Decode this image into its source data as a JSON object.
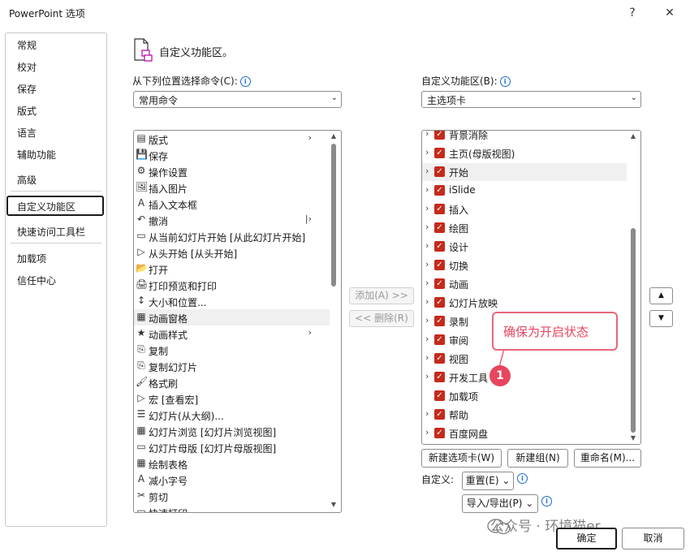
{
  "window": {
    "title": "PowerPoint 选项",
    "help": "?",
    "close": "✕"
  },
  "sidebar": {
    "items": [
      {
        "label": "常规"
      },
      {
        "label": "校对"
      },
      {
        "label": "保存"
      },
      {
        "label": "版式"
      },
      {
        "label": "语言"
      },
      {
        "label": "辅助功能"
      },
      {
        "label": "高级"
      },
      {
        "label": "自定义功能区",
        "selected": true
      },
      {
        "label": "快速访问工具栏"
      },
      {
        "label": "加载项"
      },
      {
        "label": "信任中心"
      }
    ]
  },
  "header": {
    "title": "自定义功能区。"
  },
  "left": {
    "label": "从下列位置选择命令(C):",
    "dropdown_value": "常用命令",
    "commands": [
      {
        "icon": "▤",
        "label": "版式",
        "sub": "›"
      },
      {
        "icon": "💾",
        "label": "保存"
      },
      {
        "icon": "⚙",
        "label": "操作设置"
      },
      {
        "icon": "🖼",
        "label": "插入图片"
      },
      {
        "icon": "A",
        "label": "插入文本框"
      },
      {
        "icon": "↶",
        "label": "撤消",
        "sub": "|›"
      },
      {
        "icon": "▭",
        "label": "从当前幻灯片开始 [从此幻灯片开始]"
      },
      {
        "icon": "▷",
        "label": "从头开始 [从头开始]"
      },
      {
        "icon": "📂",
        "label": "打开"
      },
      {
        "icon": "🖨",
        "label": "打印预览和打印"
      },
      {
        "icon": "↕",
        "label": "大小和位置..."
      },
      {
        "icon": "▦",
        "label": "动画窗格"
      },
      {
        "icon": "★",
        "label": "动画样式",
        "sub": "›"
      },
      {
        "icon": "⎘",
        "label": "复制"
      },
      {
        "icon": "⎘",
        "label": "复制幻灯片"
      },
      {
        "icon": "🖌",
        "label": "格式刷"
      },
      {
        "icon": "▷",
        "label": "宏 [查看宏]"
      },
      {
        "icon": "☰",
        "label": "幻灯片(从大纲)..."
      },
      {
        "icon": "▦",
        "label": "幻灯片浏览 [幻灯片浏览视图]"
      },
      {
        "icon": "▭",
        "label": "幻灯片母版 [幻灯片母版视图]"
      },
      {
        "icon": "▦",
        "label": "绘制表格"
      },
      {
        "icon": "A",
        "label": "减小字号"
      },
      {
        "icon": "✂",
        "label": "剪切"
      },
      {
        "icon": "▭",
        "label": "快速打印"
      }
    ],
    "scroll_position": 0.0
  },
  "middle": {
    "add": "添加(A) >>",
    "remove": "<< 删除(R)"
  },
  "right": {
    "label": "自定义功能区(B):",
    "dropdown_value": "主选项卡",
    "tabs": [
      {
        "label": "背景消除",
        "expandable": true,
        "checked": true
      },
      {
        "label": "主页(母版视图)",
        "expandable": true,
        "checked": true
      },
      {
        "label": "开始",
        "expandable": true,
        "checked": true,
        "highlighted": true
      },
      {
        "label": "iSlide",
        "expandable": true,
        "checked": true
      },
      {
        "label": "插入",
        "expandable": true,
        "checked": true
      },
      {
        "label": "绘图",
        "expandable": true,
        "checked": true
      },
      {
        "label": "设计",
        "expandable": true,
        "checked": true
      },
      {
        "label": "切换",
        "expandable": true,
        "checked": true
      },
      {
        "label": "动画",
        "expandable": true,
        "checked": true
      },
      {
        "label": "幻灯片放映",
        "expandable": true,
        "checked": true
      },
      {
        "label": "录制",
        "expandable": true,
        "checked": true
      },
      {
        "label": "审阅",
        "expandable": true,
        "checked": true
      },
      {
        "label": "视图",
        "expandable": true,
        "checked": true
      },
      {
        "label": "开发工具",
        "expandable": true,
        "checked": true
      },
      {
        "label": "加载项",
        "expandable": false,
        "checked": true
      },
      {
        "label": "帮助",
        "expandable": true,
        "checked": true
      },
      {
        "label": "百度网盘",
        "expandable": true,
        "checked": true
      }
    ],
    "move_up": "▲",
    "move_down": "▼",
    "new_tab": "新建选项卡(W)",
    "new_group": "新建组(N)",
    "rename": "重命名(M)...",
    "customize_label": "自定义:",
    "reset": "重置(E) ⌄",
    "import_export": "导入/导出(P) ⌄"
  },
  "annotation": {
    "callout": "确保为开启状态",
    "badge": "1"
  },
  "watermark": "公众号 · 环境猫er",
  "footer": {
    "ok": "确定",
    "cancel": "取消"
  },
  "colors": {
    "checkbox": "#c42b1c",
    "callout": "#e8465e"
  }
}
